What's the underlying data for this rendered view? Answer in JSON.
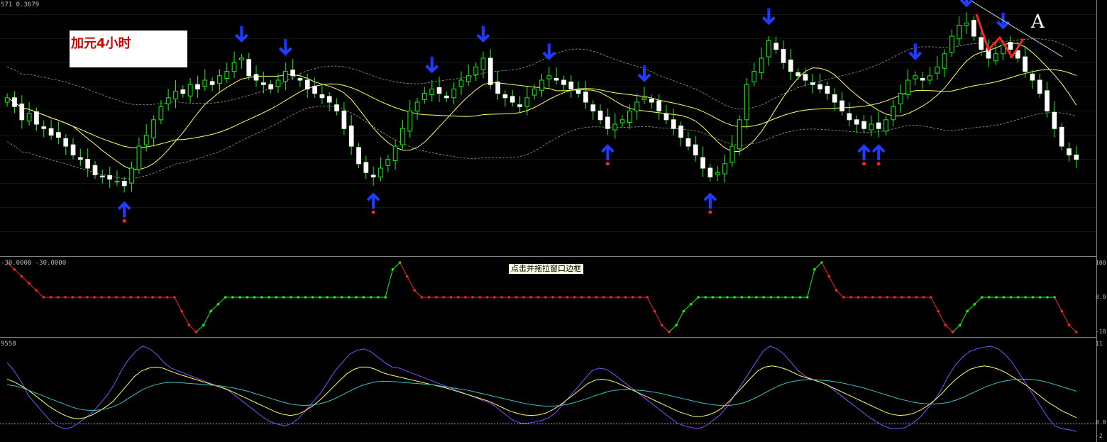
{
  "main_header": "571 0.3679",
  "annotation_label": "加元4小时",
  "corner_letter": "A",
  "tooltip_text": "点击并拖拉窗口边框",
  "panel2_header": "-30.0000 -30.0000",
  "panel3_header": "9558",
  "right_axis_panel2": [
    "100",
    "0.0",
    "-10"
  ],
  "right_axis_panel3": [
    "11",
    "0.0",
    "-2"
  ],
  "colors": {
    "bull_candle": "#00ff00",
    "bear_candle": "#ffffff",
    "ma_yellow": "#ffff66",
    "band_gray": "#9a9a9a",
    "arrow_blue": "#1f3cff",
    "dot_red": "#ff2020",
    "dot_blue": "#2222ff",
    "trend_red": "#ff2020",
    "signal_green": "#00ff00",
    "signal_red": "#ff2020",
    "osc_purple": "#8a4cff",
    "osc_yellow": "#ffff66",
    "osc_cyan": "#40c0c0"
  },
  "chart_data": [
    {
      "type": "candlestick",
      "panel": "price",
      "y_range": [
        0,
        100
      ],
      "closes": [
        62,
        58,
        52,
        55,
        50,
        48,
        45,
        44,
        40,
        36,
        34,
        30,
        27,
        26,
        25,
        24,
        22,
        30,
        40,
        45,
        52,
        58,
        62,
        65,
        64,
        68,
        66,
        70,
        68,
        72,
        74,
        78,
        80,
        72,
        70,
        68,
        66,
        70,
        74,
        72,
        70,
        66,
        64,
        62,
        60,
        56,
        48,
        40,
        32,
        28,
        26,
        30,
        34,
        40,
        48,
        56,
        60,
        64,
        66,
        64,
        62,
        66,
        70,
        72,
        76,
        80,
        68,
        64,
        62,
        60,
        58,
        62,
        66,
        70,
        72,
        70,
        68,
        66,
        64,
        60,
        56,
        52,
        48,
        50,
        52,
        56,
        60,
        62,
        60,
        56,
        52,
        48,
        44,
        40,
        36,
        30,
        26,
        28,
        32,
        40,
        52,
        68,
        74,
        80,
        88,
        84,
        78,
        74,
        72,
        70,
        68,
        66,
        64,
        60,
        56,
        52,
        50,
        48,
        50,
        48,
        52,
        58,
        64,
        70,
        72,
        70,
        72,
        76,
        82,
        90,
        95,
        96,
        90,
        84,
        80,
        82,
        86,
        84,
        80,
        74,
        70,
        64,
        56,
        48,
        40,
        36,
        34
      ]
    },
    {
      "type": "line",
      "panel": "signal",
      "y_range": [
        -100,
        100
      ],
      "values": [
        100,
        80,
        60,
        40,
        20,
        0,
        0,
        0,
        0,
        0,
        0,
        0,
        0,
        0,
        0,
        0,
        0,
        0,
        0,
        0,
        0,
        0,
        0,
        0,
        -40,
        -80,
        -100,
        -80,
        -40,
        -20,
        0,
        0,
        0,
        0,
        0,
        0,
        0,
        0,
        0,
        0,
        0,
        0,
        0,
        0,
        0,
        0,
        0,
        0,
        0,
        0,
        0,
        0,
        0,
        80,
        100,
        60,
        20,
        0,
        0,
        0,
        0,
        0,
        0,
        0,
        0,
        0,
        0,
        0,
        0,
        0,
        0,
        0,
        0,
        0,
        0,
        0,
        0,
        0,
        0,
        0,
        0,
        0,
        0,
        0,
        0,
        0,
        0,
        0,
        0,
        -40,
        -80,
        -100,
        -80,
        -40,
        -20,
        0,
        0,
        0,
        0,
        0,
        0,
        0,
        0,
        0,
        0,
        0,
        0,
        0,
        0,
        0,
        0,
        80,
        100,
        60,
        20,
        0,
        0,
        0,
        0,
        0,
        0,
        0,
        0,
        0,
        0,
        0,
        0,
        0,
        -40,
        -80,
        -100,
        -80,
        -40,
        -20,
        0,
        0,
        0,
        0,
        0,
        0,
        0,
        0,
        0,
        0,
        0,
        -40,
        -80,
        -100
      ]
    },
    {
      "type": "line",
      "panel": "oscillator",
      "series": [
        {
          "name": "",
          "color_key": "osc_purple",
          "values": [
            70,
            55,
            35,
            10,
            -5,
            -20,
            -35,
            -45,
            -50,
            -48,
            -40,
            -30,
            -20,
            -5,
            10,
            30,
            55,
            75,
            90,
            100,
            95,
            85,
            70,
            60,
            55,
            50,
            45,
            40,
            35,
            30,
            25,
            20,
            10,
            0,
            -10,
            -20,
            -30,
            -38,
            -42,
            -45,
            -40,
            -30,
            -15,
            0,
            15,
            35,
            55,
            70,
            85,
            92,
            95,
            90,
            80,
            70,
            62,
            60,
            55,
            50,
            45,
            40,
            35,
            30,
            25,
            20,
            15,
            10,
            5,
            0,
            -5,
            -15,
            -25,
            -35,
            -40,
            -40,
            -38,
            -35,
            -30,
            -20,
            -5,
            10,
            25,
            40,
            55,
            60,
            58,
            50,
            40,
            30,
            20,
            10,
            0,
            -10,
            -20,
            -30,
            -40,
            -45,
            -48,
            -50,
            -45,
            -35,
            -25,
            -10,
            10,
            30,
            50,
            70,
            90,
            100,
            95,
            85,
            70,
            55,
            45,
            40,
            35,
            30,
            20,
            10,
            0,
            -10,
            -20,
            -30,
            -38,
            -45,
            -50,
            -50,
            -48,
            -40,
            -30,
            -15,
            0,
            20,
            45,
            65,
            80,
            90,
            95,
            98,
            100,
            95,
            85,
            70,
            50,
            30,
            10,
            -10,
            -30,
            -45,
            -50,
            -52,
            -55
          ]
        },
        {
          "name": "",
          "color_key": "osc_yellow",
          "values": [
            40,
            35,
            28,
            20,
            10,
            0,
            -10,
            -18,
            -25,
            -30,
            -32,
            -30,
            -25,
            -18,
            -10,
            0,
            15,
            30,
            45,
            55,
            60,
            62,
            60,
            55,
            50,
            46,
            42,
            38,
            34,
            30,
            26,
            22,
            16,
            10,
            4,
            -2,
            -8,
            -14,
            -20,
            -24,
            -26,
            -24,
            -18,
            -10,
            0,
            12,
            25,
            38,
            50,
            58,
            62,
            62,
            58,
            52,
            48,
            45,
            42,
            39,
            36,
            33,
            30,
            27,
            24,
            20,
            16,
            12,
            8,
            4,
            0,
            -6,
            -12,
            -18,
            -22,
            -25,
            -26,
            -25,
            -22,
            -16,
            -8,
            2,
            12,
            22,
            32,
            38,
            40,
            38,
            34,
            28,
            22,
            16,
            10,
            4,
            -2,
            -8,
            -14,
            -20,
            -24,
            -28,
            -28,
            -25,
            -20,
            -12,
            0,
            14,
            28,
            42,
            55,
            62,
            64,
            62,
            58,
            52,
            46,
            42,
            38,
            34,
            28,
            22,
            16,
            10,
            4,
            -2,
            -8,
            -14,
            -20,
            -24,
            -26,
            -25,
            -22,
            -16,
            -8,
            2,
            14,
            28,
            40,
            50,
            58,
            62,
            64,
            62,
            58,
            52,
            44,
            36,
            28,
            18,
            8,
            -2,
            -10,
            -18,
            -24,
            -30
          ]
        },
        {
          "name": "",
          "color_key": "osc_cyan",
          "values": [
            30,
            28,
            25,
            20,
            15,
            10,
            5,
            0,
            -5,
            -10,
            -14,
            -16,
            -17,
            -16,
            -14,
            -10,
            -4,
            4,
            12,
            20,
            26,
            30,
            33,
            34,
            34,
            33,
            32,
            31,
            30,
            29,
            28,
            26,
            24,
            21,
            18,
            14,
            10,
            6,
            2,
            -2,
            -5,
            -7,
            -8,
            -7,
            -5,
            -2,
            3,
            9,
            16,
            22,
            28,
            32,
            35,
            36,
            36,
            35,
            34,
            33,
            32,
            31,
            30,
            28,
            26,
            24,
            22,
            20,
            17,
            14,
            11,
            8,
            5,
            2,
            -1,
            -4,
            -6,
            -8,
            -9,
            -9,
            -8,
            -6,
            -3,
            1,
            5,
            10,
            14,
            18,
            20,
            21,
            21,
            20,
            19,
            17,
            15,
            12,
            9,
            6,
            3,
            0,
            -3,
            -5,
            -7,
            -8,
            -8,
            -6,
            -3,
            2,
            8,
            15,
            22,
            28,
            33,
            36,
            38,
            39,
            39,
            38,
            37,
            35,
            33,
            30,
            27,
            24,
            20,
            16,
            12,
            8,
            4,
            1,
            -2,
            -4,
            -5,
            -5,
            -4,
            -2,
            2,
            7,
            13,
            19,
            25,
            30,
            34,
            37,
            39,
            40,
            40,
            39,
            37,
            34,
            30,
            26,
            22,
            18
          ]
        }
      ]
    }
  ]
}
